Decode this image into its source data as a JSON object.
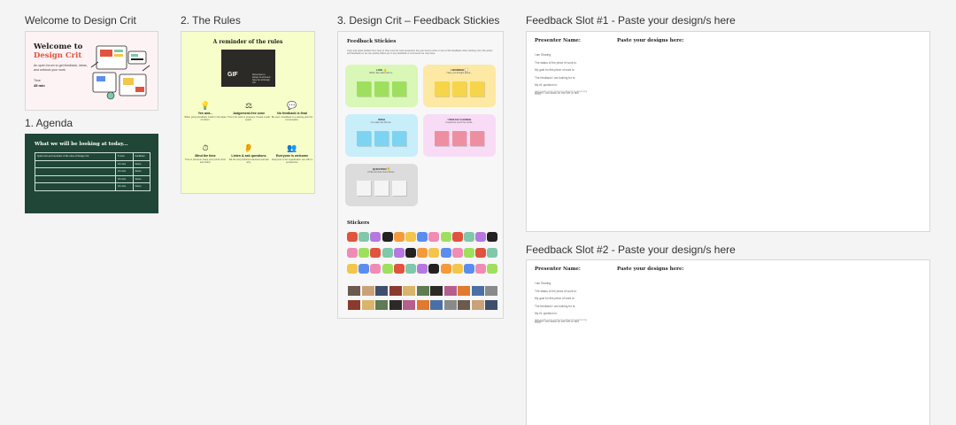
{
  "frames": {
    "welcome": {
      "label": "Welcome to Design Crit"
    },
    "agenda": {
      "label": "1. Agenda"
    },
    "rules": {
      "label": "2. The Rules"
    },
    "stickies": {
      "label": "3. Design Crit – Feedback Stickies"
    },
    "slot1": {
      "label": "Feedback Slot #1 - Paste your design/s here"
    },
    "slot2": {
      "label": "Feedback Slot #2 - Paste your design/s here"
    }
  },
  "welcome": {
    "title_line1": "Welcome to",
    "title_line2": "Design Crit",
    "description": "An open forum to get feedback, ideas, and unblock your work",
    "time_label": "Time",
    "time_value": "45 min"
  },
  "agenda": {
    "title": "What we will be looking at today...",
    "rows": [
      [
        "Quick intro and reminder of the rules of Design Crit",
        "5 mins",
        "Facilitator"
      ],
      [
        "",
        "10 mins",
        "Name"
      ],
      [
        "",
        "10 mins",
        "Name"
      ],
      [
        "",
        "10 mins",
        "Name"
      ],
      [
        "",
        "10 mins",
        "Name"
      ]
    ]
  },
  "rules": {
    "title": "A reminder of the rules",
    "gif_label": "GIF",
    "gif_caption": "Remember to always be kind and have fun at Design Crit",
    "items": [
      {
        "icon": "bulb",
        "heading": "Yes and...",
        "text": "When giving feedback, build on the ideas of others."
      },
      {
        "icon": "scale",
        "heading": "Judgement-free zone",
        "text": "This is for work in progress. Create a safe space."
      },
      {
        "icon": "speech",
        "heading": "No feedback is final",
        "text": "Be open. Feedback is a starting point for conversation."
      },
      {
        "icon": "clock",
        "heading": "Mind the time",
        "text": "Time is precious. Keep your points short and sharp."
      },
      {
        "icon": "ear",
        "heading": "Listen & ask questions",
        "text": "Tell the story behind a decision and ask why."
      },
      {
        "icon": "people",
        "heading": "Everyone is welcome",
        "text": "Everyone in the organization can offer a perspective."
      }
    ]
  },
  "stickies": {
    "title": "Feedback Stickies",
    "description": "Copy and paste stickies from here to drop onto the work presented. Do your best to write on one of the feedback colors ranking, from the action and feedback so we can quickly follow-up on any feedback or comments we may have.",
    "clusters": [
      {
        "label": "LIKE 👍",
        "sub": "What I like about this is...",
        "color": "#d9f7b6",
        "note": "#9ee05e"
      },
      {
        "label": "I WONDER 💭",
        "sub": "Have you thought about...",
        "color": "#fde8a4",
        "note": "#f7d54a"
      },
      {
        "label": "WISH",
        "sub": "I'm really into this as...",
        "color": "#c8eefa",
        "note": "#7dd3f2"
      },
      {
        "label": "I WOULD CHANGE",
        "sub": "It would be cool if we could...",
        "color": "#f8dcf5",
        "note": "#ee8fa1"
      },
      {
        "label": "QUESTION 🤔",
        "sub": "I'd like to know more about...",
        "color": "#dcdcdc",
        "note": "#f4f4f4"
      }
    ],
    "stickers_title": "Stickers",
    "sticker_row1": [
      "WE",
      "WE",
      "ATTY",
      "OLÉ",
      "PROBLEM",
      "WOW",
      "HAPPY",
      "100",
      "GREAT IDEAS"
    ],
    "sticker_row3": [
      "👏",
      "😍",
      "🎉",
      "😂",
      "🔥",
      "👍",
      "💯",
      "❤",
      "🤔",
      "🙌",
      "✨",
      "⭐",
      "💡",
      "🎯",
      "🚀",
      "🤯",
      "🙏",
      "🥳"
    ]
  },
  "slot": {
    "presenter_label": "Presenter Name:",
    "paste_label": "Paste your designs here:",
    "questions": [
      "I am Sharing:",
      "The status of the piece of work is:",
      "My goal for this piece of work is:",
      "The feedback I am looking for is:",
      "My #1 question is:",
      "Where I am stuck on the live or still:"
    ],
    "note": "(Get people some context on what we're presenting today)"
  }
}
